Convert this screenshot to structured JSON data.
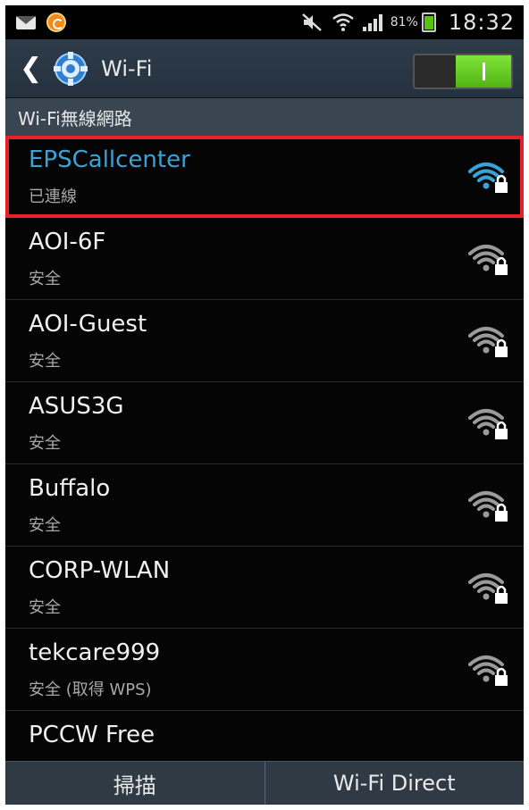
{
  "status_bar": {
    "battery_text": "81%",
    "battery_level": 0.81,
    "time": "18:32",
    "icons": [
      "mail-icon",
      "sync-icon",
      "mute-icon",
      "wifi-signal-icon",
      "cell-signal-icon",
      "battery-icon"
    ]
  },
  "action_bar": {
    "title": "Wi-Fi",
    "toggle_on": true
  },
  "section_header": "Wi-Fi無線網路",
  "networks": [
    {
      "name": "EPSCallcenter",
      "status": "已連線",
      "signal": 4,
      "secured": true,
      "connected": true
    },
    {
      "name": "AOI-6F",
      "status": "安全",
      "signal": 3,
      "secured": true,
      "connected": false
    },
    {
      "name": "AOI-Guest",
      "status": "安全",
      "signal": 3,
      "secured": true,
      "connected": false
    },
    {
      "name": "ASUS3G",
      "status": "安全",
      "signal": 3,
      "secured": true,
      "connected": false
    },
    {
      "name": "Buffalo",
      "status": "安全",
      "signal": 3,
      "secured": true,
      "connected": false
    },
    {
      "name": "CORP-WLAN",
      "status": "安全",
      "signal": 3,
      "secured": true,
      "connected": false
    },
    {
      "name": "tekcare999",
      "status": "安全 (取得 WPS)",
      "signal": 3,
      "secured": true,
      "connected": false
    },
    {
      "name": "PCCW Free",
      "status": "",
      "signal": 0,
      "secured": false,
      "connected": false
    }
  ],
  "bottom_bar": {
    "scan_label": "掃描",
    "wifi_direct_label": "Wi-Fi Direct"
  },
  "colors": {
    "accent_blue": "#3aa3d6",
    "toggle_green": "#5cc61a",
    "selection_red": "#e8202a",
    "signal_grey": "#8a8a8a"
  }
}
